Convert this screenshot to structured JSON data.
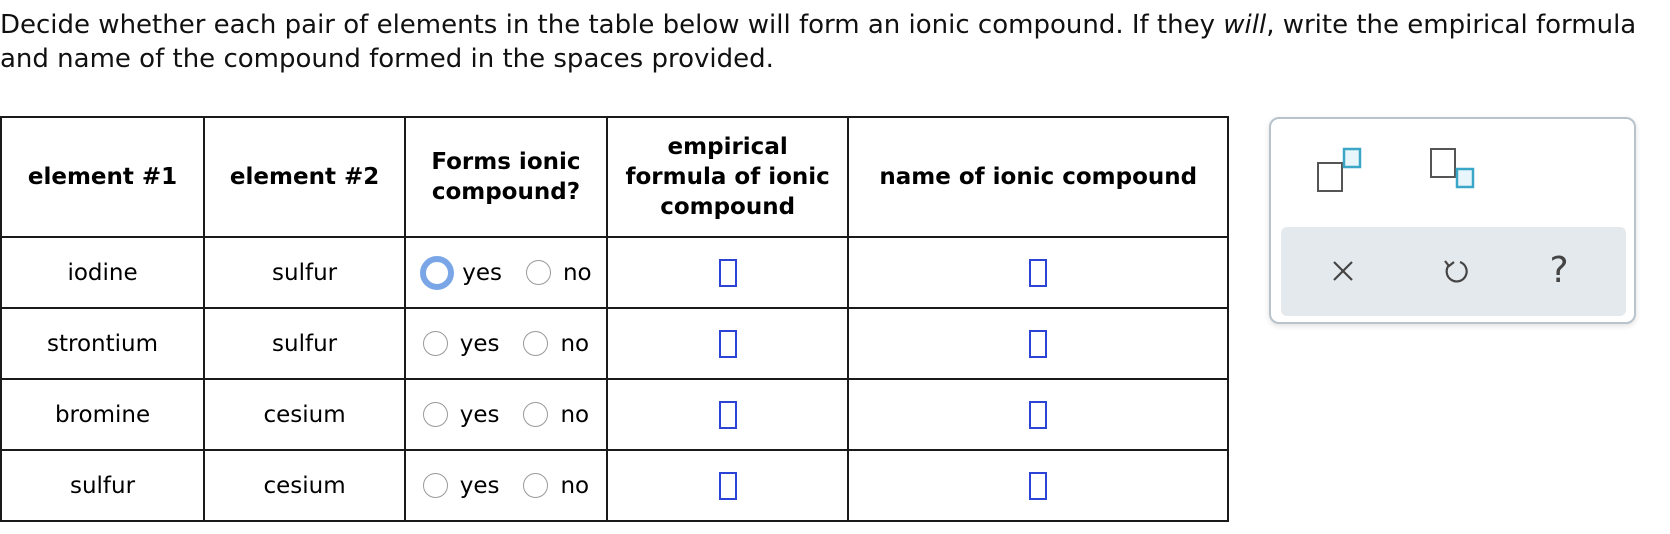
{
  "question": {
    "part1": "Decide whether each pair of elements in the table below will form an ionic compound. If they ",
    "emphasis": "will",
    "part2": ", write the empirical formula and name of the compound formed in the spaces provided."
  },
  "table": {
    "headers": [
      "element #1",
      "element #2",
      "Forms ionic compound?",
      "empirical formula of ionic compound",
      "name of ionic compound"
    ],
    "rows": [
      {
        "element1": "iodine",
        "element2": "sulfur",
        "yes_label": "yes",
        "no_label": "no"
      },
      {
        "element1": "strontium",
        "element2": "sulfur",
        "yes_label": "yes",
        "no_label": "no"
      },
      {
        "element1": "bromine",
        "element2": "cesium",
        "yes_label": "yes",
        "no_label": "no"
      },
      {
        "element1": "sulfur",
        "element2": "cesium",
        "yes_label": "yes",
        "no_label": "no"
      }
    ]
  },
  "toolbar": {
    "icons": [
      "superscript-icon",
      "subscript-icon",
      "clear-icon",
      "undo-icon",
      "help-icon"
    ],
    "help_glyph": "?",
    "accent_color": "#3aa7c9",
    "blank_border_color": "#2c44d6",
    "focus_ring_color": "#7aa6e8"
  }
}
